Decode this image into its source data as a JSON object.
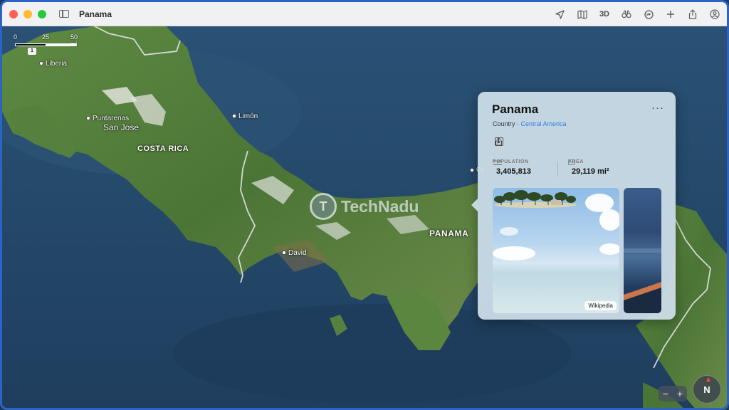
{
  "window": {
    "title": "Panama",
    "toolbar": {
      "view_3d_label": "3D"
    }
  },
  "map": {
    "scale": {
      "labels": [
        "0",
        "25",
        "50 mi"
      ],
      "badge": "1"
    },
    "places": {
      "liberia": "Liberia",
      "puntarenas": "Puntarenas",
      "san_jose": "San Jose",
      "limon": "Limón",
      "costa_rica": "COSTA RICA",
      "panama": "PANAMA",
      "david": "David",
      "colon_partial": "Co"
    },
    "watermark": "TechNadu",
    "colors": {
      "ocean": "#254a6b",
      "land": "#4e7a3c",
      "border": "#dcdcdc"
    }
  },
  "card": {
    "title": "Panama",
    "kind": "Country",
    "separator": " · ",
    "region": "Central America",
    "more_label": "···",
    "population": {
      "label": "POPULATION",
      "value": "3,405,813"
    },
    "area": {
      "label": "AREA",
      "value": "29,119 mi²"
    },
    "photo_credit": "Wikipedia",
    "link_color": "#2f7de1"
  },
  "controls": {
    "zoom_out": "−",
    "zoom_in": "+",
    "compass": "N"
  }
}
